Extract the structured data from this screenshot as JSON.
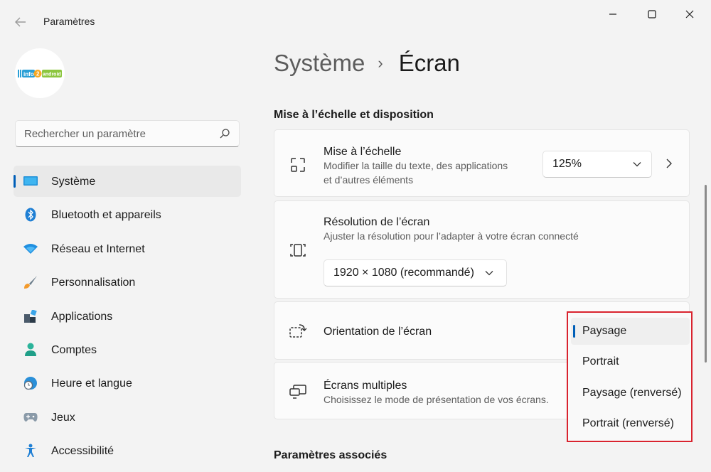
{
  "window": {
    "title": "Paramètres"
  },
  "profile": {
    "logo_text_left": "info",
    "logo_text_num": "2",
    "logo_text_right": "android"
  },
  "search": {
    "placeholder": "Rechercher un paramètre"
  },
  "sidebar": {
    "items": [
      {
        "label": "Système",
        "icon": "monitor-icon",
        "active": true
      },
      {
        "label": "Bluetooth et appareils",
        "icon": "bluetooth-icon"
      },
      {
        "label": "Réseau et Internet",
        "icon": "wifi-icon"
      },
      {
        "label": "Personnalisation",
        "icon": "brush-icon"
      },
      {
        "label": "Applications",
        "icon": "apps-icon"
      },
      {
        "label": "Comptes",
        "icon": "person-icon"
      },
      {
        "label": "Heure et langue",
        "icon": "clock-globe-icon"
      },
      {
        "label": "Jeux",
        "icon": "gamepad-icon"
      },
      {
        "label": "Accessibilité",
        "icon": "accessibility-icon"
      }
    ]
  },
  "breadcrumb": {
    "parent": "Système",
    "separator": "›",
    "current": "Écran"
  },
  "sections": {
    "layout_title": "Mise à l’échelle et disposition",
    "related_title": "Paramètres associés"
  },
  "cards": {
    "scale": {
      "title": "Mise à l’échelle",
      "desc_line1": "Modifier la taille du texte, des applications",
      "desc_line2": "et d’autres éléments",
      "value": "125%"
    },
    "resolution": {
      "title": "Résolution de l’écran",
      "desc": "Ajuster la résolution pour l’adapter à  votre  écran connecté",
      "value": "1920 × 1080 (recommandé)"
    },
    "orientation": {
      "title": "Orientation de l’écran"
    },
    "multiple": {
      "title": "Écrans multiples",
      "desc": "Choisissez le mode de présentation de vos écrans."
    }
  },
  "orientation_menu": {
    "options": [
      "Paysage",
      "Portrait",
      "Paysage (renversé)",
      "Portrait (renversé)"
    ],
    "selected": "Paysage"
  },
  "colors": {
    "accent": "#005fb8",
    "highlight_border": "#d9232e"
  }
}
